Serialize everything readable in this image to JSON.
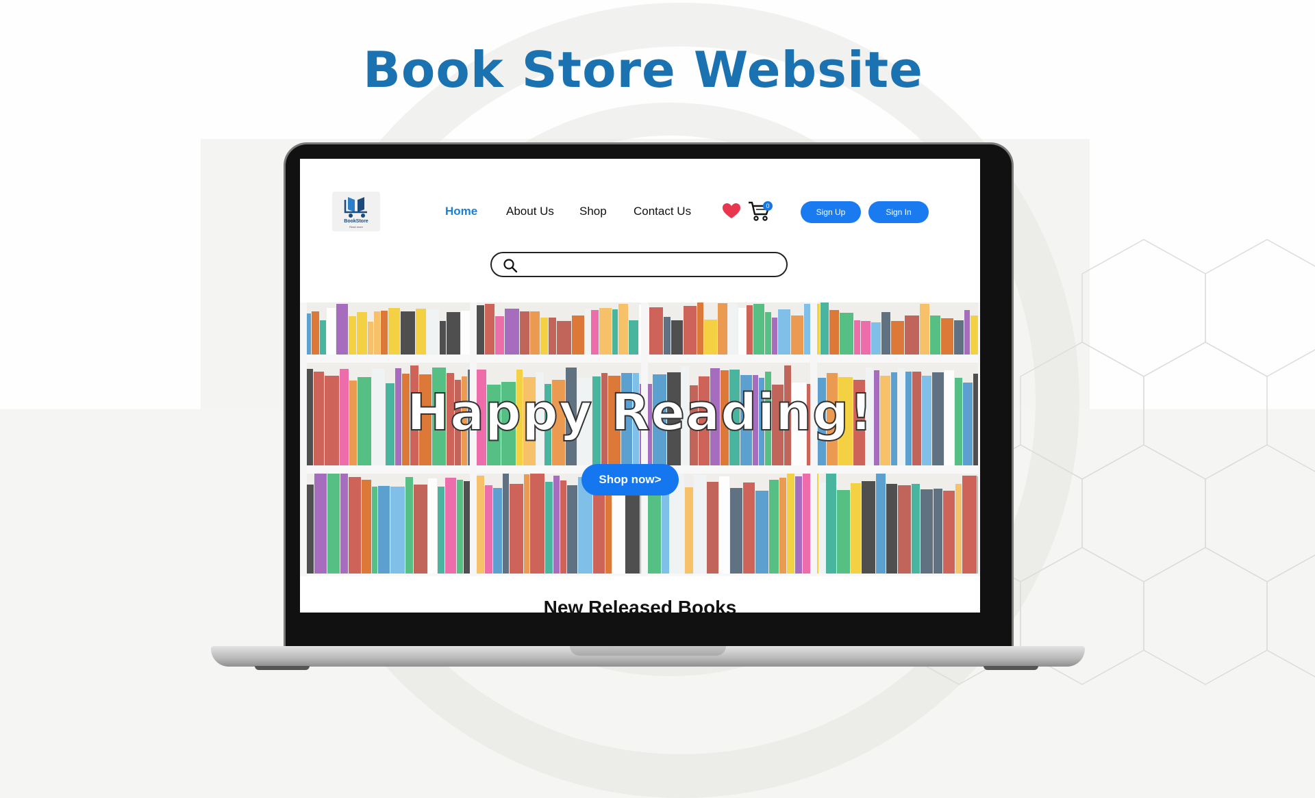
{
  "page": {
    "title": "Book Store Website"
  },
  "site": {
    "logo": {
      "name": "BookStore",
      "tagline": "Read more"
    },
    "nav": [
      {
        "label": "Home",
        "active": true
      },
      {
        "label": "About Us",
        "active": false
      },
      {
        "label": "Shop",
        "active": false
      },
      {
        "label": "Contact Us",
        "active": false
      }
    ],
    "icons": {
      "wishlist": "heart-icon",
      "cart": "cart-icon",
      "search": "search-icon"
    },
    "cart_count": "0",
    "auth": {
      "sign_up": "Sign Up",
      "sign_in": "Sign In"
    },
    "search": {
      "placeholder": "",
      "value": ""
    },
    "hero": {
      "title": "Happy Reading!",
      "cta": "Shop now>"
    },
    "section_title": "New Released Books"
  },
  "colors": {
    "accent": "#1a7bf0",
    "title": "#1a72b0",
    "heart": "#e8364f"
  }
}
